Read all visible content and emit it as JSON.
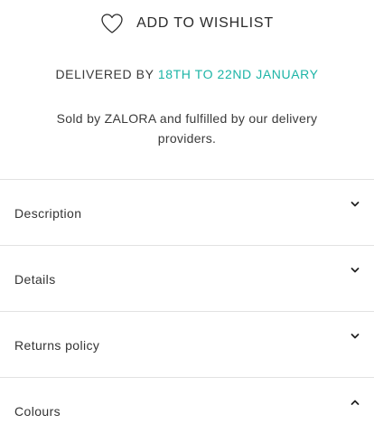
{
  "wishlist": {
    "icon": "heart-outline-icon",
    "label": "ADD TO WISHLIST"
  },
  "delivery": {
    "prefix": "DELIVERED BY",
    "dates": "18TH TO 22ND JANUARY",
    "accent_color": "#1cb4a6"
  },
  "seller_note": "Sold by ZALORA and fulfilled by our delivery providers.",
  "accordion": {
    "items": [
      {
        "label": "Description",
        "icon": "chevron-down-icon",
        "expanded": false
      },
      {
        "label": "Details",
        "icon": "chevron-down-icon",
        "expanded": false
      },
      {
        "label": "Returns policy",
        "icon": "chevron-down-icon",
        "expanded": false
      },
      {
        "label": "Colours",
        "icon": "chevron-up-icon",
        "expanded": true
      }
    ]
  }
}
